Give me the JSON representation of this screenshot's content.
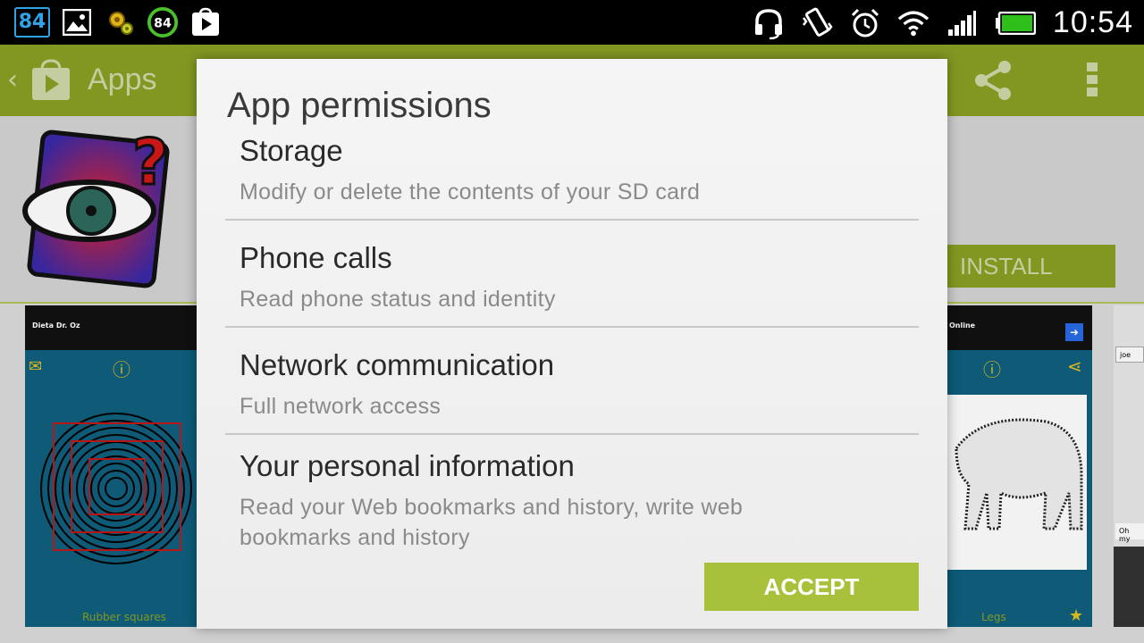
{
  "status_bar": {
    "notification_count": "84",
    "battery_badge": "84",
    "time": "10:54",
    "left_icons": [
      "image-icon",
      "gear-icon",
      "battery-84-icon",
      "play-store-icon"
    ],
    "right_icons": [
      "headset-icon",
      "vibrate-icon",
      "alarm-icon",
      "wifi-icon",
      "signal-icon",
      "battery-icon"
    ]
  },
  "action_bar": {
    "title": "Apps",
    "color": "#8aa024"
  },
  "app_page": {
    "install_label": "INSTALL",
    "screenshot_captions": [
      "Rubber squares",
      "Legs"
    ],
    "ad_text_1": "Dieta Dr. Oz",
    "ad_text_2": "Online",
    "chat_input": "joe",
    "chat_msg": "Oh my"
  },
  "dialog": {
    "title": "App permissions",
    "permissions": [
      {
        "title": "Storage",
        "description": "Modify or delete the contents of your SD card"
      },
      {
        "title": "Phone calls",
        "description": "Read phone status and identity"
      },
      {
        "title": "Network communication",
        "description": "Full network access"
      },
      {
        "title": "Your personal information",
        "description": "Read your Web bookmarks and history, write web bookmarks and history"
      }
    ],
    "accept_label": "ACCEPT",
    "accent": "#a7c23a"
  }
}
